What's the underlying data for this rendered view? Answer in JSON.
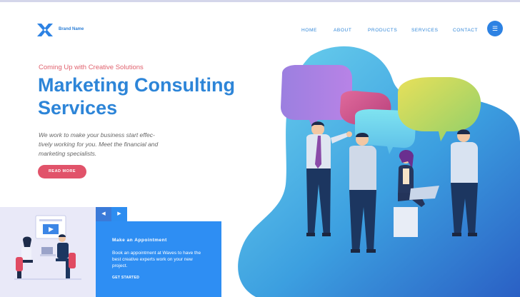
{
  "header": {
    "brand": "Brand Name",
    "nav": [
      "HOME",
      "ABOUT",
      "PRODUCTS",
      "SERVICES",
      "CONTACT"
    ],
    "menu_icon": "☰"
  },
  "hero": {
    "tagline": "Coming Up with Creative Solutions",
    "title": "Marketing Consulting Services",
    "description": "We work to make your business start effec-tively working for you. Meet the financial and marketing specialists.",
    "cta": "READ MORE"
  },
  "card": {
    "prev_icon": "◀",
    "next_icon": "▶",
    "title": "Make an Appointment",
    "text": "Book an appointment at Waves to have the best creative experts work on your new project.",
    "cta": "GET STARTED"
  },
  "colors": {
    "accent": "#2d85d8",
    "cta": "#e1536a",
    "card_blue": "#2e8ef3",
    "card_bg": "#e9e9f8"
  }
}
